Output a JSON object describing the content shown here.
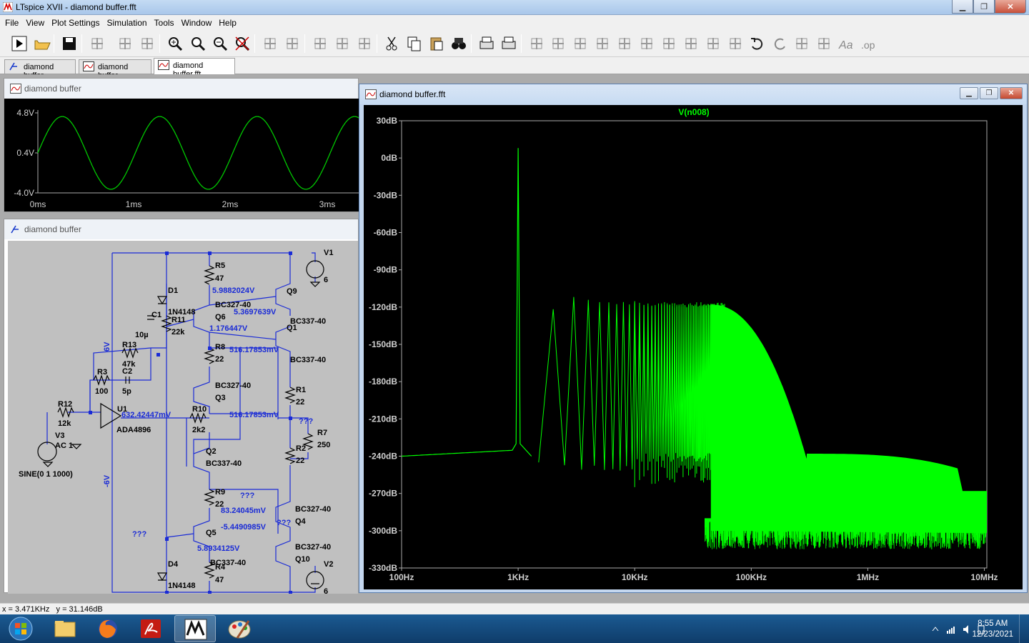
{
  "app": {
    "title": "LTspice XVII - diamond buffer.fft",
    "min_glyph": "▁",
    "max_glyph": "❐",
    "close_glyph": "✕"
  },
  "menu": [
    "File",
    "View",
    "Plot Settings",
    "Simulation",
    "Tools",
    "Window",
    "Help"
  ],
  "toolbar_icons": [
    "run-icon",
    "open-icon",
    "save-icon",
    "control-panel-icon",
    "halt-icon",
    "pan-hand-icon",
    "zoom-in-icon",
    "zoom-full-icon",
    "zoom-out-icon",
    "zoom-cancel-icon",
    "autorange-icon",
    "pick-visible-traces-icon",
    "tile-horizontal-icon",
    "cascade-icon",
    "tile-vertical-icon",
    "cut-icon",
    "copy-icon",
    "paste-icon",
    "find-icon",
    "print-preview-icon",
    "print-icon",
    "draw-wire-icon",
    "ground-icon",
    "label-net-icon",
    "resistor-icon",
    "capacitor-icon",
    "inductor-icon",
    "diode-icon",
    "component-icon",
    "move-icon",
    "drag-icon",
    "undo-icon",
    "redo-icon",
    "rotate-icon",
    "mirror-icon",
    "text-icon",
    "spice-directive-icon"
  ],
  "tabs": [
    {
      "label": "diamond buffer",
      "icon": "schematic-tab-icon"
    },
    {
      "label": "diamond buffer",
      "icon": "waveform-tab-icon"
    },
    {
      "label": "diamond buffer.fft",
      "icon": "waveform-tab-icon"
    }
  ],
  "wave_window": {
    "title": "diamond buffer",
    "chart_data": {
      "type": "line",
      "title": "",
      "xlabel": "",
      "ylabel": "",
      "x_ticks": [
        "0ms",
        "1ms",
        "2ms",
        "3ms"
      ],
      "y_ticks": [
        "4.8V",
        "0.4V",
        "-4.0V"
      ],
      "xlim": [
        0,
        3.3
      ],
      "ylim": [
        -4.0,
        4.8
      ],
      "series": [
        {
          "color": "#00c800",
          "function": "sine",
          "amplitude": 4.0,
          "offset": 0.4,
          "frequency_khz": 1.0
        }
      ],
      "grid": false
    }
  },
  "schematic_window": {
    "title": "diamond buffer",
    "components": [
      {
        "ref": "V1",
        "value": "6"
      },
      {
        "ref": "V2",
        "value": "6"
      },
      {
        "ref": "V3",
        "value": "AC 1",
        "extra": "SINE(0 1 1000)"
      },
      {
        "ref": "R5",
        "value": "47"
      },
      {
        "ref": "R4",
        "value": "47"
      },
      {
        "ref": "R11",
        "value": "22k"
      },
      {
        "ref": "R13",
        "value": "47k"
      },
      {
        "ref": "R3",
        "value": "100"
      },
      {
        "ref": "R12",
        "value": "12k"
      },
      {
        "ref": "R8",
        "value": "22"
      },
      {
        "ref": "R9",
        "value": "22"
      },
      {
        "ref": "R10",
        "value": "2k2"
      },
      {
        "ref": "R1",
        "value": "22"
      },
      {
        "ref": "R2",
        "value": "22"
      },
      {
        "ref": "R7",
        "value": "250"
      },
      {
        "ref": "C1",
        "value": "10µ"
      },
      {
        "ref": "C2",
        "value": "5p"
      },
      {
        "ref": "D1",
        "value": "1N4148"
      },
      {
        "ref": "D4",
        "value": "1N4148"
      },
      {
        "ref": "Q9",
        "value": "BC327-40"
      },
      {
        "ref": "Q6",
        "value": "BC327-40"
      },
      {
        "ref": "Q1",
        "value": "BC337-40"
      },
      {
        "ref": "Q3",
        "value": "BC327-40"
      },
      {
        "ref": "Q2",
        "value": "BC337-40"
      },
      {
        "ref": "Q5",
        "value": "BC337-40"
      },
      {
        "ref": "Q4",
        "value": "BC327-40"
      },
      {
        "ref": "Q10",
        "value": "BC327-40"
      },
      {
        "ref": "U1",
        "value": "ADA4896"
      }
    ],
    "net_labels": [
      "6V",
      "-6V"
    ],
    "node_voltages": [
      "5.9882024V",
      "5.3697639V",
      "1.176447V",
      "516.17853mV",
      "632.42447mV",
      "516.17853mV",
      "83.24045mV",
      "-5.4490985V",
      "5.8934125V"
    ],
    "unknown_markers": [
      "???",
      "???",
      "???",
      "???"
    ],
    "bc337_extra": "BC337-40"
  },
  "fft_window": {
    "title": "diamond buffer.fft",
    "chart_data": {
      "type": "line",
      "title": "",
      "series": [
        {
          "name": "V(n008)",
          "color": "#00ff00"
        }
      ],
      "xlabel": "",
      "ylabel": "",
      "x_scale": "log",
      "x_ticks": [
        "100Hz",
        "1KHz",
        "10KHz",
        "100KHz",
        "1MHz",
        "10MHz"
      ],
      "xlim_hz": [
        100,
        10500000
      ],
      "y_ticks": [
        "30dB",
        "0dB",
        "-30dB",
        "-60dB",
        "-90dB",
        "-120dB",
        "-150dB",
        "-180dB",
        "-210dB",
        "-240dB",
        "-270dB",
        "-300dB",
        "-330dB"
      ],
      "ylim_db": [
        -330,
        30
      ],
      "fundamental": {
        "freq_hz": 1000,
        "db": 8
      },
      "harmonic_peaks_db": [
        -118,
        -111,
        -112,
        -113,
        -114,
        -115,
        -115,
        -115,
        -115,
        -115,
        -115,
        -115,
        -116,
        -116,
        -117,
        -117
      ],
      "noise_floor_db": -240,
      "plateau": {
        "start_hz": 300000,
        "db": -238,
        "end_hz": 6000000
      },
      "grid": false
    }
  },
  "status": {
    "x": "x = 3.471KHz",
    "y": "y = 31.146dB"
  },
  "taskbar": {
    "apps": [
      "windows-explorer-icon",
      "firefox-icon",
      "acrobat-icon",
      "ltspice-icon",
      "paint-icon"
    ],
    "time": "8:55 AM",
    "date": "12/23/2021"
  }
}
